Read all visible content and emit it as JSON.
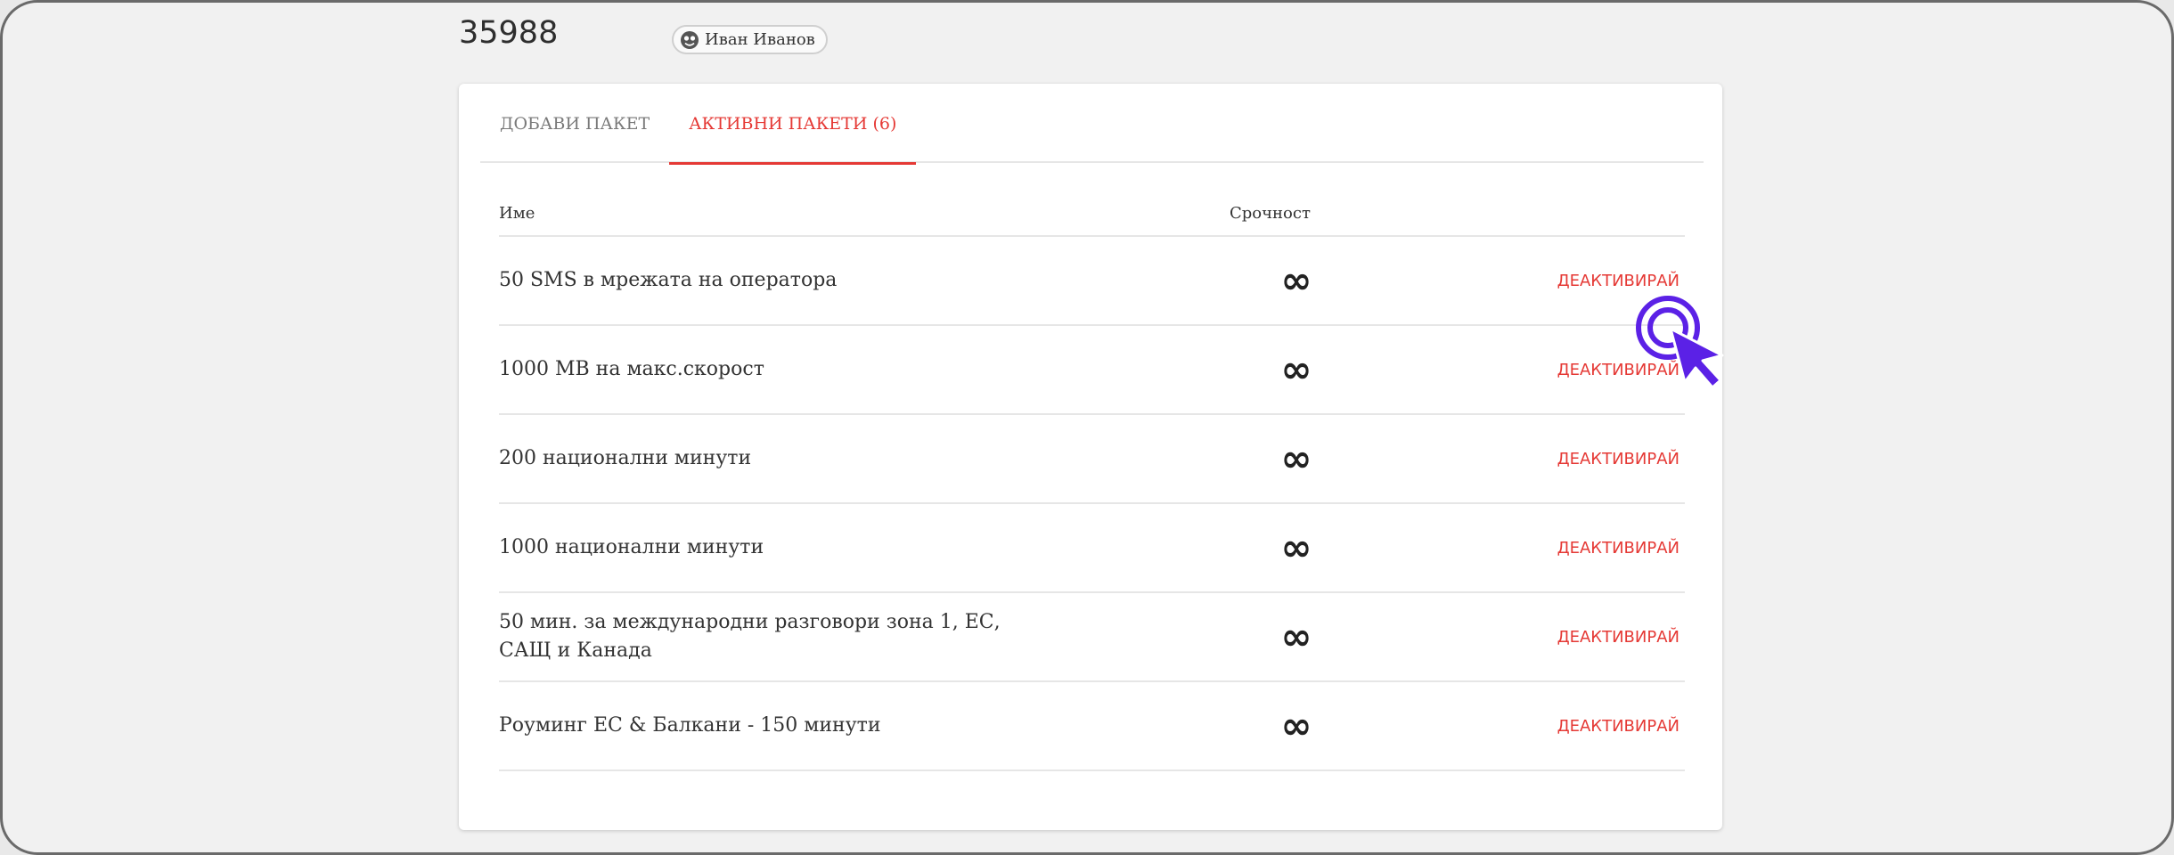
{
  "header": {
    "number": "35988",
    "user_name": "Иван Иванов"
  },
  "tabs": [
    {
      "label": "ДОБАВИ ПАКЕТ",
      "active": false
    },
    {
      "label": "АКТИВНИ ПАКЕТИ (6)",
      "active": true
    }
  ],
  "table": {
    "col_name": "Име",
    "col_term": "Срочност",
    "rows": [
      {
        "name": "50 SMS в мрежата на оператора",
        "term": "∞",
        "action": "ДЕАКТИВИРАЙ"
      },
      {
        "name": "1000 MB на макс.скорост",
        "term": "∞",
        "action": "ДЕАКТИВИРАЙ"
      },
      {
        "name": "200 национални минути",
        "term": "∞",
        "action": "ДЕАКТИВИРАЙ"
      },
      {
        "name": "1000 национални минути",
        "term": "∞",
        "action": "ДЕАКТИВИРАЙ"
      },
      {
        "name": "50 мин. за международни разговори зона 1, ЕС, САЩ и Канада",
        "term": "∞",
        "action": "ДЕАКТИВИРАЙ"
      },
      {
        "name": "Роуминг ЕС & Балкани - 150 минути",
        "term": "∞",
        "action": "ДЕАКТИВИРАЙ"
      }
    ]
  },
  "colors": {
    "accent": "#e53935",
    "cursor": "#5b21e6"
  },
  "icons": {
    "user_chip": "user-face-icon",
    "cursor": "click-cursor-icon"
  }
}
